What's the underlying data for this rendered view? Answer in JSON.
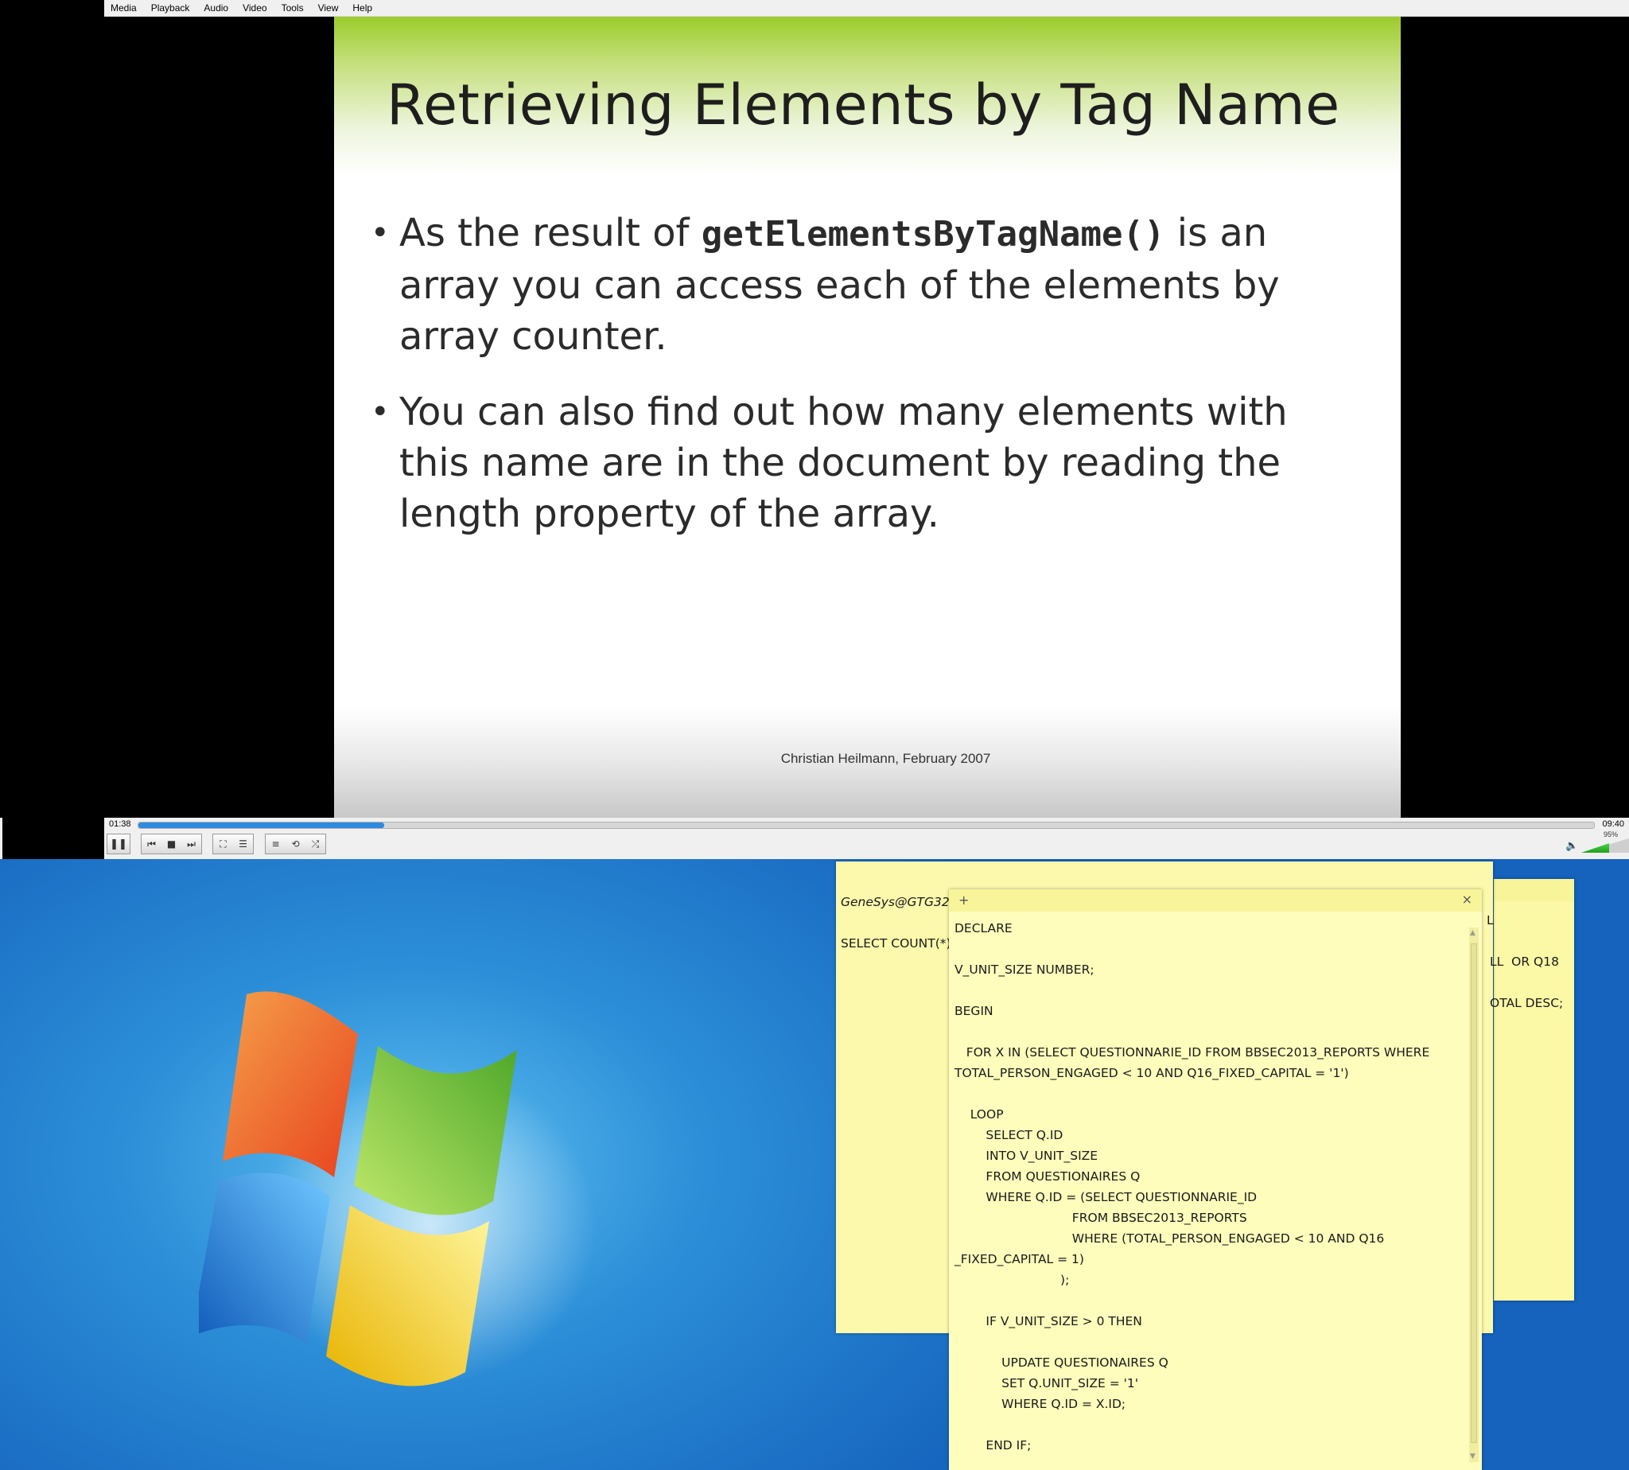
{
  "menu": [
    "Media",
    "Playback",
    "Audio",
    "Video",
    "Tools",
    "View",
    "Help"
  ],
  "slide": {
    "title": "Retrieving Elements by Tag Name",
    "bullet1": {
      "pre": "As the result of ",
      "code": "getElementsByTagName()",
      "post": " is an array you can access each of the elements by array counter."
    },
    "bullet2": "You can also find out how many elements with this name are in the document by reading the length property of the array.",
    "credit": "Christian Heilmann, February 2007"
  },
  "player": {
    "elapsed": "01:38",
    "total": "09:40",
    "progress_fraction": 0.169,
    "volume": "95%",
    "volume_fraction": 0.95
  },
  "notes": {
    "back": {
      "line1": "GeneSys@GTG321",
      "line2": "SELECT COUNT(*)"
    },
    "right": {
      "line1": "L",
      "line2": "LL  OR Q18",
      "line3": "OTAL DESC;"
    },
    "front": {
      "add_label": "+",
      "close_label": "×",
      "code": "DECLARE\n\nV_UNIT_SIZE NUMBER;\n\nBEGIN\n\n   FOR X IN (SELECT QUESTIONNARIE_ID FROM BBSEC2013_REPORTS WHERE\nTOTAL_PERSON_ENGAGED < 10 AND Q16_FIXED_CAPITAL = '1')\n\n    LOOP\n        SELECT Q.ID\n        INTO V_UNIT_SIZE\n        FROM QUESTIONAIRES Q\n        WHERE Q.ID = (SELECT QUESTIONNARIE_ID\n                              FROM BBSEC2013_REPORTS\n                              WHERE (TOTAL_PERSON_ENGAGED < 10 AND Q16\n_FIXED_CAPITAL = 1)\n                           );\n\n        IF V_UNIT_SIZE > 0 THEN\n\n            UPDATE QUESTIONAIRES Q\n            SET Q.UNIT_SIZE = '1'\n            WHERE Q.ID = X.ID;\n\n        END IF;"
    }
  },
  "icons": {
    "pause": "pause-icon",
    "prev": "previous-icon",
    "stop": "stop-icon",
    "next": "next-icon",
    "fullscreen": "fullscreen-icon",
    "extended": "extended-settings-icon",
    "playlist": "playlist-icon",
    "loop": "loop-icon",
    "shuffle": "shuffle-icon",
    "speaker": "speaker-icon"
  }
}
